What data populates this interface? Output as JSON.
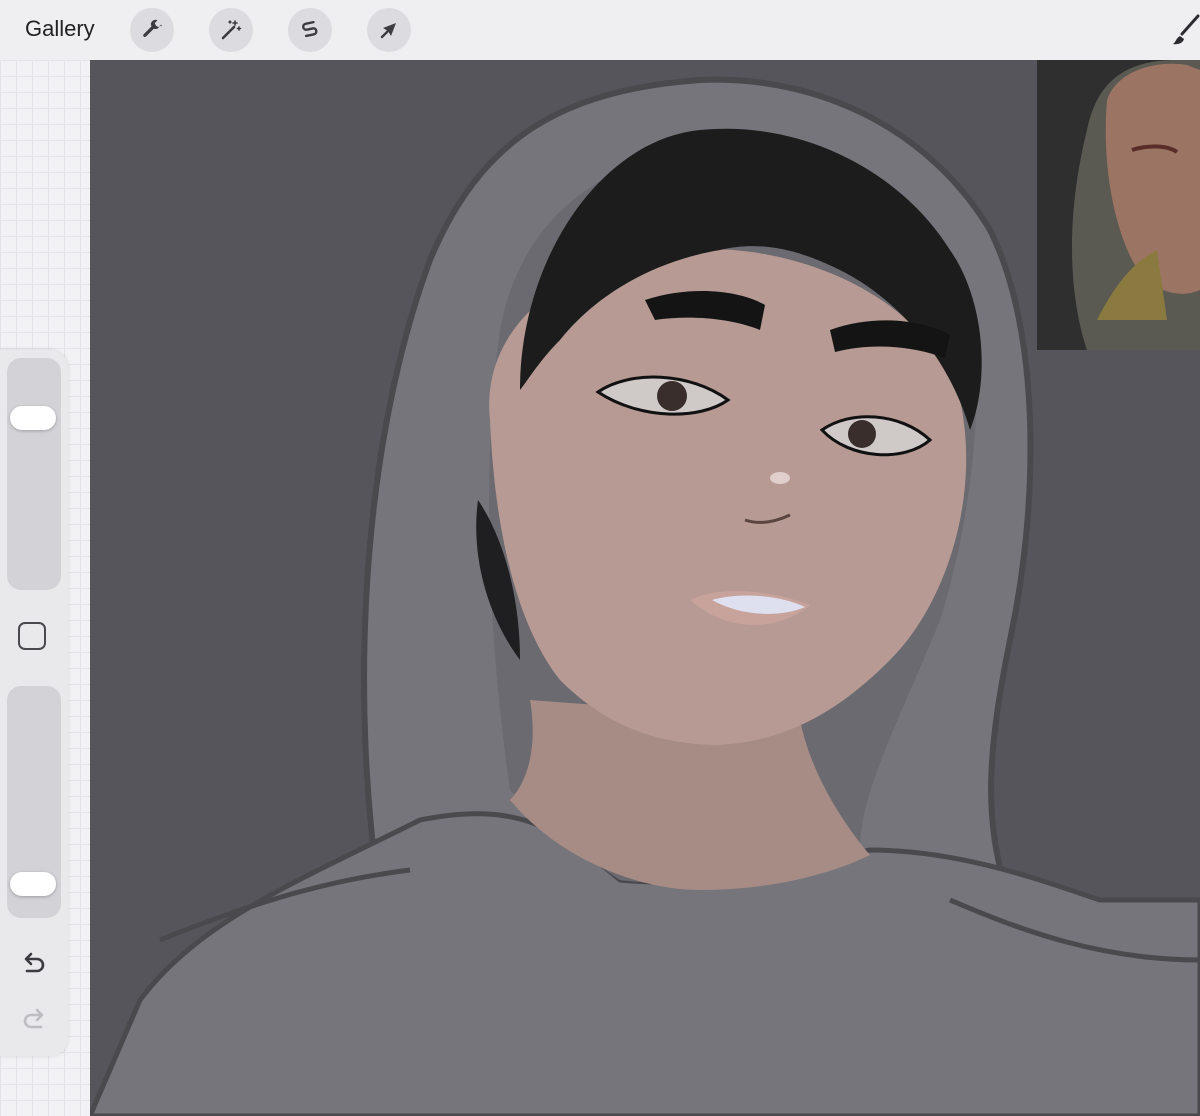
{
  "topbar": {
    "gallery_label": "Gallery",
    "tools": [
      {
        "name": "wrench-icon",
        "role": "actions"
      },
      {
        "name": "magic-wand-icon",
        "role": "adjustments"
      },
      {
        "name": "selection-s-icon",
        "role": "selection"
      },
      {
        "name": "arrow-cursor-icon",
        "role": "transform"
      }
    ],
    "brush_icon": "paintbrush-icon"
  },
  "sidebar": {
    "brush_size_level": 0.78,
    "opacity_level": 0.09,
    "modify_button_icon": "square-icon",
    "undo_icon": "undo-arrow-icon",
    "redo_icon": "redo-arrow-icon"
  },
  "colors": {
    "topbar_bg": "#efeff1",
    "canvas_bg": "#56555b",
    "hoodie": "#76757b",
    "skin": "#b69a93",
    "hair": "#1c1c1c"
  }
}
